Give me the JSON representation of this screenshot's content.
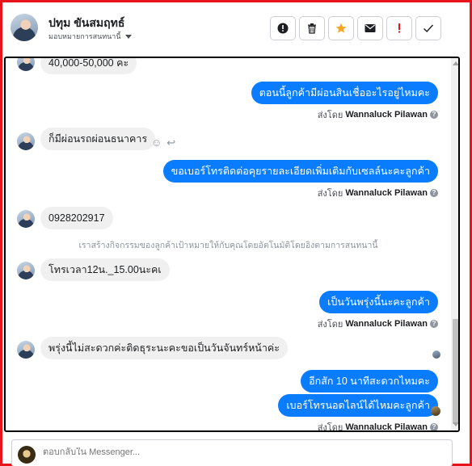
{
  "header": {
    "contact_name": "ปทุม ขันสมฤทธ์",
    "assign_label": "มอบหมายการสนทนานี้",
    "actions": [
      {
        "name": "alert-button",
        "icon": "!"
      },
      {
        "name": "delete-button",
        "icon": "trash"
      },
      {
        "name": "star-button",
        "icon": "star"
      },
      {
        "name": "email-button",
        "icon": "envelope"
      },
      {
        "name": "spam-button",
        "icon": "!"
      },
      {
        "name": "done-button",
        "icon": "check"
      }
    ],
    "star_color": "#f5a623",
    "spam_color": "#e8141b"
  },
  "messages": {
    "m0": "40,000-50,000 คะ",
    "m1": "ตอนนี้ลูกค้ามีผ่อนสินเชื่ออะไรอยู่ไหมคะ",
    "m2": "ก็มีผ่อนรถผ่อนธนาคาร",
    "m3": "ขอเบอร์โทรติดต่อคุยรายละเอียดเพิ่มเติมกับเซลล์นะคะลูกค้า",
    "m4": "0928202917",
    "system": "เราสร้างกิจกรรมของลูกค้าเป้าหมายให้กับคุณโดยอัตโนมัติโดยอิงตามการสนทนานี้",
    "m5": "โทรเวลา12น._15.00นะคเ",
    "m6": "เป็นวันพรุ่งนี้นะคะลูกค้า",
    "m7": "พรุ่งนี้ไม่สะดวกค่ะติดธุระนะคะขอเป็นวันจันทร์หน้าค่ะ",
    "m8": "อีกสัก 10 นาทีสะดวกไหมคะ",
    "m9": "เบอร์โทรนอดไลน์ได้ไหมคะลูกค้า"
  },
  "sent_by": {
    "prefix": "ส่งโดย",
    "agent": "Wannaluck Pilawan",
    "help": "?"
  },
  "composer": {
    "placeholder": "ตอบกลับใน Messenger..."
  },
  "colors": {
    "outgoing_bubble": "#0a7cff",
    "incoming_bubble": "#f0f0f0",
    "frame_border": "#e8141b"
  }
}
